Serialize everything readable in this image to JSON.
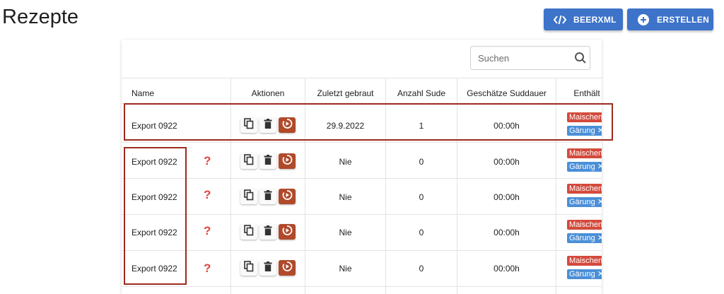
{
  "header": {
    "title": "Rezepte",
    "beerxml_label": "BEERXML",
    "create_label": "ERSTELLEN"
  },
  "search": {
    "placeholder": "Suchen"
  },
  "table": {
    "columns": [
      "Name",
      "Aktionen",
      "Zuletzt gebraut",
      "Anzahl Sude",
      "Geschätze Suddauer",
      "Enthält"
    ],
    "rows": [
      {
        "name": "Export 0922",
        "unknown": false,
        "last_brewed": "29.9.2022",
        "count": "1",
        "duration": "00:00h",
        "tags": [
          "Maischen",
          "Gärung ✕"
        ]
      },
      {
        "name": "Export 0922",
        "unknown": true,
        "last_brewed": "Nie",
        "count": "0",
        "duration": "00:00h",
        "tags": [
          "Maischen",
          "Gärung ✕"
        ]
      },
      {
        "name": "Export 0922",
        "unknown": true,
        "last_brewed": "Nie",
        "count": "0",
        "duration": "00:00h",
        "tags": [
          "Maischen",
          "Gärung ✕"
        ]
      },
      {
        "name": "Export 0922",
        "unknown": true,
        "last_brewed": "Nie",
        "count": "0",
        "duration": "00:00h",
        "tags": [
          "Maischen",
          "Gärung ✕"
        ]
      },
      {
        "name": "Export 0922",
        "unknown": true,
        "last_brewed": "Nie",
        "count": "0",
        "duration": "00:00h",
        "tags": [
          "Maischen",
          "Gärung ✕"
        ]
      }
    ]
  },
  "icons": {
    "beerxml": "code-icon",
    "create": "plus-circle-icon",
    "search": "search-icon",
    "copy": "copy-icon",
    "delete": "trash-icon",
    "brew": "play-timer-icon",
    "unknown": "question-mark-icon"
  },
  "colors": {
    "primary": "#3d73c9",
    "brew_action": "#b04a2a",
    "tag_mash": "#d44a3c",
    "tag_fermentation": "#4a8fd8",
    "highlight": "#9c2b1e",
    "question": "#e0443c"
  }
}
